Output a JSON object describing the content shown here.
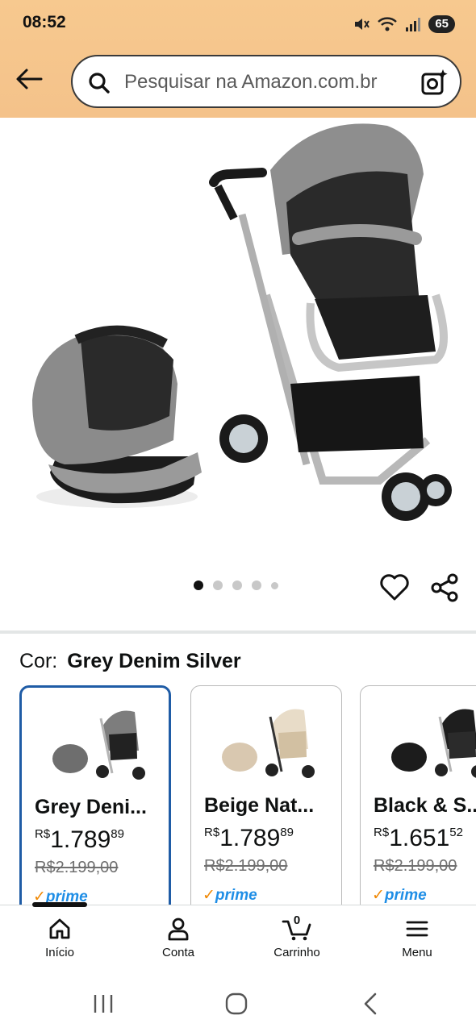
{
  "status_bar": {
    "time": "08:52",
    "battery": "65"
  },
  "header": {
    "search_placeholder": "Pesquisar na Amazon.com.br"
  },
  "carousel": {
    "dots_count": 5,
    "active_index": 0
  },
  "selection": {
    "label": "Cor:",
    "value": "Grey Denim Silver"
  },
  "variants": [
    {
      "name": "Grey Deni...",
      "currency": "R$",
      "price_int": "1.789",
      "price_cents": "89",
      "old_price": "R$2.199,00",
      "prime": "prime",
      "selected": true
    },
    {
      "name": "Beige Nat...",
      "currency": "R$",
      "price_int": "1.789",
      "price_cents": "89",
      "old_price": "R$2.199,00",
      "prime": "prime",
      "selected": false
    },
    {
      "name": "Black & S...",
      "currency": "R$",
      "price_int": "1.651",
      "price_cents": "52",
      "old_price": "R$2.199,00",
      "prime": "prime",
      "selected": false
    }
  ],
  "bottom_nav": {
    "home": "Início",
    "account": "Conta",
    "cart": "Carrinho",
    "cart_count": "0",
    "menu": "Menu"
  },
  "colors": {
    "header_bg": "#f4c28a",
    "selected_border": "#1f5ca6",
    "prime_blue": "#1f8ee6",
    "prime_check": "#f08804"
  }
}
